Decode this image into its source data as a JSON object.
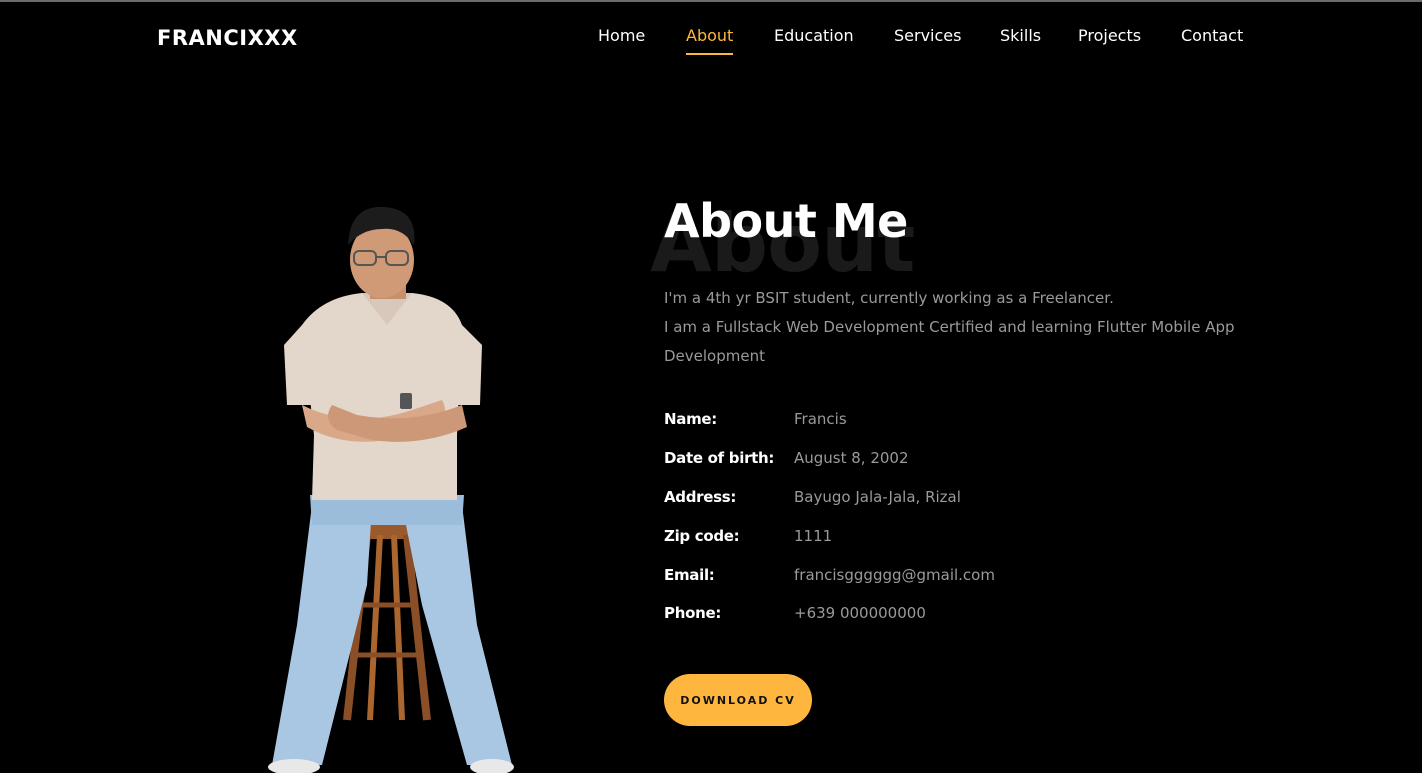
{
  "brand": {
    "logo": "FRANCIXXX"
  },
  "nav": {
    "items": [
      {
        "label": "Home",
        "active": false
      },
      {
        "label": "About",
        "active": true
      },
      {
        "label": "Education",
        "active": false
      },
      {
        "label": "Services",
        "active": false
      },
      {
        "label": "Skills",
        "active": false
      },
      {
        "label": "Projects",
        "active": false
      },
      {
        "label": "Contact",
        "active": false
      }
    ]
  },
  "about": {
    "background_word": "About",
    "title": "About Me",
    "description": [
      "I'm a 4th yr BSIT student, currently working as a Freelancer.",
      "I am a Fullstack Web Development Certified and learning Flutter Mobile App Development"
    ],
    "info": [
      {
        "label": "Name:",
        "value": "Francis"
      },
      {
        "label": "Date of birth:",
        "value": "August 8, 2002"
      },
      {
        "label": "Address:",
        "value": "Bayugo Jala-Jala, Rizal"
      },
      {
        "label": "Zip code:",
        "value": "1111"
      },
      {
        "label": "Email:",
        "value": "francisgggggg@gmail.com"
      },
      {
        "label": "Phone:",
        "value": "+639 000000000"
      }
    ],
    "cv_button": "DOWNLOAD CV"
  },
  "colors": {
    "accent": "#ffb63e",
    "background": "#000000",
    "muted_text": "#9a9a9a"
  }
}
